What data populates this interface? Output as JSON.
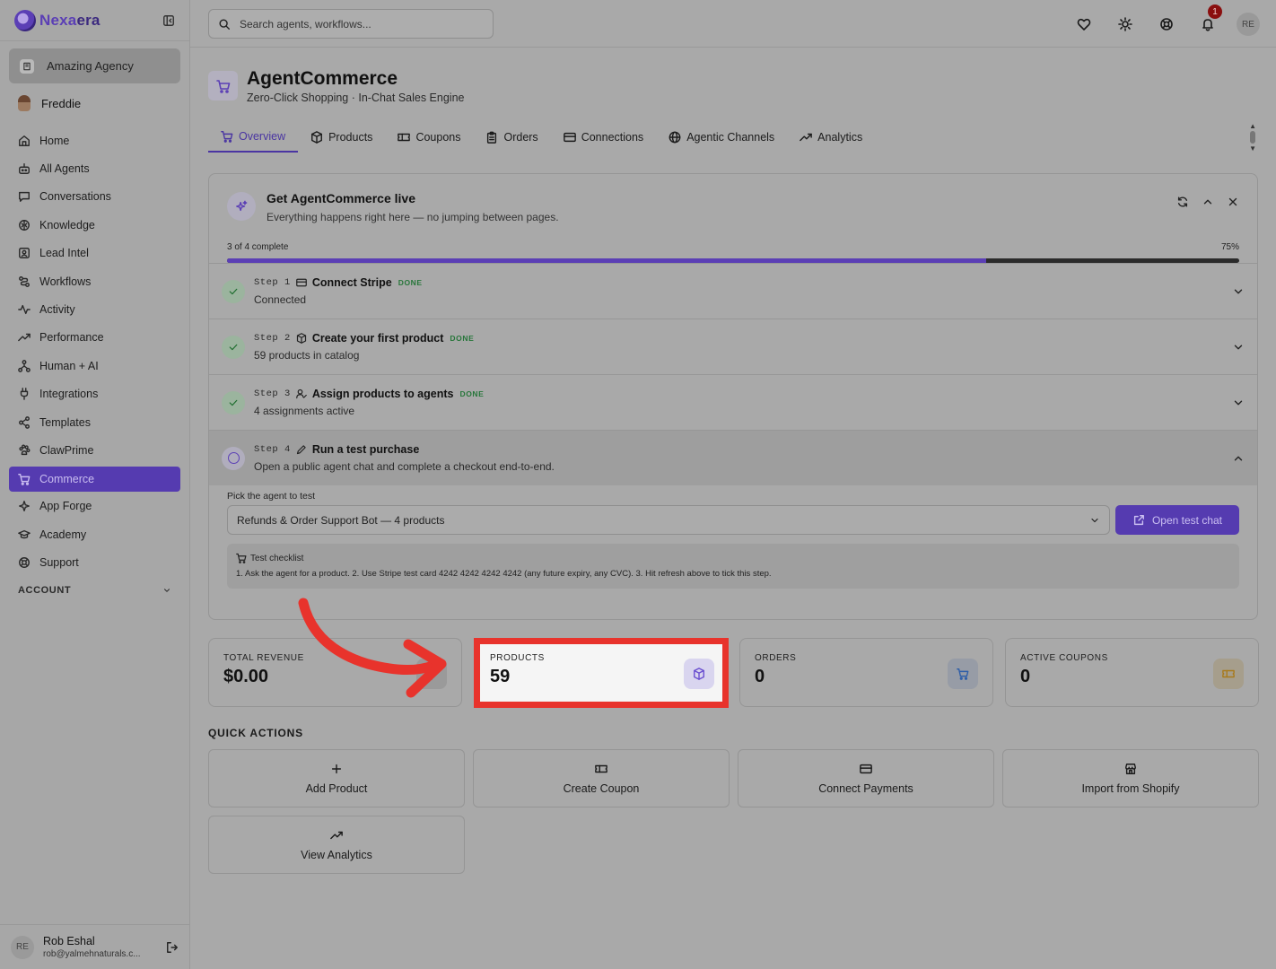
{
  "brand": {
    "name_a": "Nexa",
    "name_b": "era"
  },
  "sidebar": {
    "agency": "Amazing Agency",
    "user": "Freddie",
    "items": [
      {
        "label": "Home",
        "icon": "home-icon"
      },
      {
        "label": "All Agents",
        "icon": "bot-icon"
      },
      {
        "label": "Conversations",
        "icon": "chat-icon"
      },
      {
        "label": "Knowledge",
        "icon": "brain-icon"
      },
      {
        "label": "Lead Intel",
        "icon": "contact-icon"
      },
      {
        "label": "Workflows",
        "icon": "route-icon"
      },
      {
        "label": "Activity",
        "icon": "pulse-icon"
      },
      {
        "label": "Performance",
        "icon": "trend-icon"
      },
      {
        "label": "Human + AI",
        "icon": "network-icon"
      },
      {
        "label": "Integrations",
        "icon": "plug-icon"
      },
      {
        "label": "Templates",
        "icon": "share-icon"
      },
      {
        "label": "ClawPrime",
        "icon": "paw-icon"
      },
      {
        "label": "Commerce",
        "icon": "cart-icon",
        "active": true
      },
      {
        "label": "App Forge",
        "icon": "sparkles-icon"
      },
      {
        "label": "Academy",
        "icon": "cap-icon"
      },
      {
        "label": "Support",
        "icon": "lifebuoy-icon"
      }
    ],
    "account_label": "ACCOUNT",
    "footer": {
      "initials": "RE",
      "name": "Rob Eshal",
      "email": "rob@yalmehnaturals.c..."
    }
  },
  "topbar": {
    "search_placeholder": "Search agents, workflows...",
    "notification_count": "1",
    "avatar_initials": "RE"
  },
  "page": {
    "title": "AgentCommerce",
    "subtitle": "Zero-Click Shopping · In-Chat Sales Engine"
  },
  "tabs": [
    {
      "label": "Overview",
      "active": true
    },
    {
      "label": "Products"
    },
    {
      "label": "Coupons"
    },
    {
      "label": "Orders"
    },
    {
      "label": "Connections"
    },
    {
      "label": "Agentic Channels"
    },
    {
      "label": "Analytics"
    }
  ],
  "setup": {
    "title": "Get AgentCommerce live",
    "subtitle": "Everything happens right here — no jumping between pages.",
    "progress_label": "3 of 4 complete",
    "progress_percent_label": "75%",
    "progress": 0.75,
    "steps": [
      {
        "no": "Step 1",
        "name": "Connect Stripe",
        "tag": "DONE",
        "desc": "Connected"
      },
      {
        "no": "Step 2",
        "name": "Create your first product",
        "tag": "DONE",
        "desc": "59 products in catalog"
      },
      {
        "no": "Step 3",
        "name": "Assign products to agents",
        "tag": "DONE",
        "desc": "4 assignments active"
      },
      {
        "no": "Step 4",
        "name": "Run a test purchase",
        "tag": "",
        "desc": "Open a public agent chat and complete a checkout end-to-end."
      }
    ],
    "pick_label": "Pick the agent to test",
    "selected_agent": "Refunds & Order Support Bot — 4 products",
    "open_chat_label": "Open test chat",
    "checklist_title": "Test checklist",
    "checklist_body": "1. Ask the agent for a product. 2. Use Stripe test card 4242  4242  4242  4242 (any future expiry, any CVC). 3. Hit refresh above to tick this step."
  },
  "stats": [
    {
      "label": "TOTAL REVENUE",
      "value": "$0.00",
      "icon": "dollar-icon",
      "color": "#8a8a8a"
    },
    {
      "label": "PRODUCTS",
      "value": "59",
      "icon": "box-icon",
      "color": "#6a4fd0"
    },
    {
      "label": "ORDERS",
      "value": "0",
      "icon": "cart-icon",
      "color": "#2e5ea8"
    },
    {
      "label": "ACTIVE COUPONS",
      "value": "0",
      "icon": "ticket-icon",
      "color": "#a87a1c"
    }
  ],
  "quick_actions": {
    "title": "QUICK ACTIONS",
    "items": [
      {
        "label": "Add Product",
        "icon": "plus-icon"
      },
      {
        "label": "Create Coupon",
        "icon": "ticket-icon"
      },
      {
        "label": "Connect Payments",
        "icon": "card-icon"
      },
      {
        "label": "Import from Shopify",
        "icon": "store-icon"
      },
      {
        "label": "View Analytics",
        "icon": "trend-icon"
      }
    ]
  },
  "colors": {
    "accent": "#553bb0",
    "highlight": "#e8332c",
    "success": "#27763a"
  }
}
